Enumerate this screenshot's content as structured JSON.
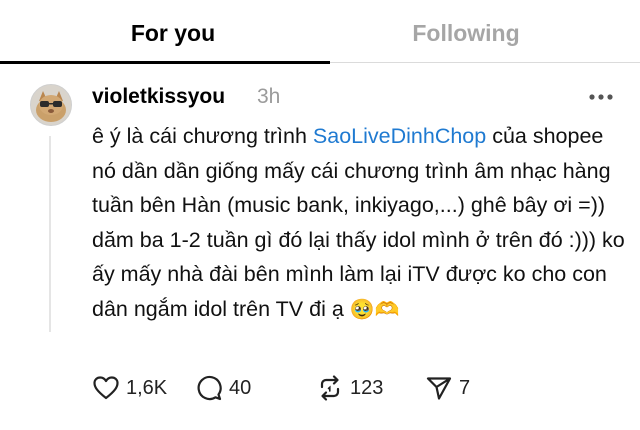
{
  "tabs": [
    {
      "label": "For you",
      "active": true
    },
    {
      "label": "Following",
      "active": false
    }
  ],
  "post": {
    "username": "violetkissyou",
    "time": "3h",
    "text_before": "ê ý là cái chương trình ",
    "hashtag": "SaoLiveDinhChop",
    "text_after": " của shopee nó dần dần giống mấy cái chương trình âm nhạc hàng tuần bên Hàn (music bank, inkiyago,...) ghê bây ơi =)) dăm ba 1-2 tuần gì đó lại thấy idol mình ở trên đó :))) ko ấy mấy nhà đài bên mình làm lại iTV được ko cho con dân ngắm idol trên TV đi ạ ",
    "emoji_1": "🥹",
    "emoji_2": "🫶"
  },
  "actions": {
    "likes": "1,6K",
    "replies": "40",
    "reposts": "123",
    "shares": "7"
  },
  "icons": {
    "like": "heart-icon",
    "reply": "comment-icon",
    "repost": "repost-icon",
    "share": "send-icon",
    "more": "more-horizontal-icon"
  },
  "colors": {
    "hashtag": "#1f7ad1",
    "inactive_tab": "#a6a6a6",
    "timestamp": "#9b9b9b"
  }
}
